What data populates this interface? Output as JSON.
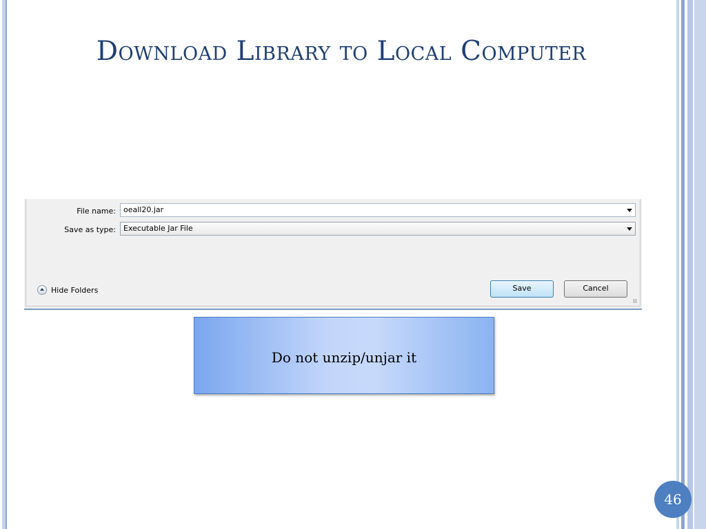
{
  "slide": {
    "title": "Download Library to Local Computer",
    "page_number": "46"
  },
  "dialog": {
    "file_name_label": "File name:",
    "file_name_value": "oeall20.jar",
    "save_as_type_label": "Save as type:",
    "save_as_type_value": "Executable Jar File",
    "hide_folders_label": "Hide Folders",
    "save_button": "Save",
    "cancel_button": "Cancel"
  },
  "callout": {
    "text": "Do not unzip/unjar it"
  },
  "colors": {
    "title": "#1f3f73",
    "accent": "#4e7fc1",
    "callout_fill": "#c3d6fa"
  }
}
